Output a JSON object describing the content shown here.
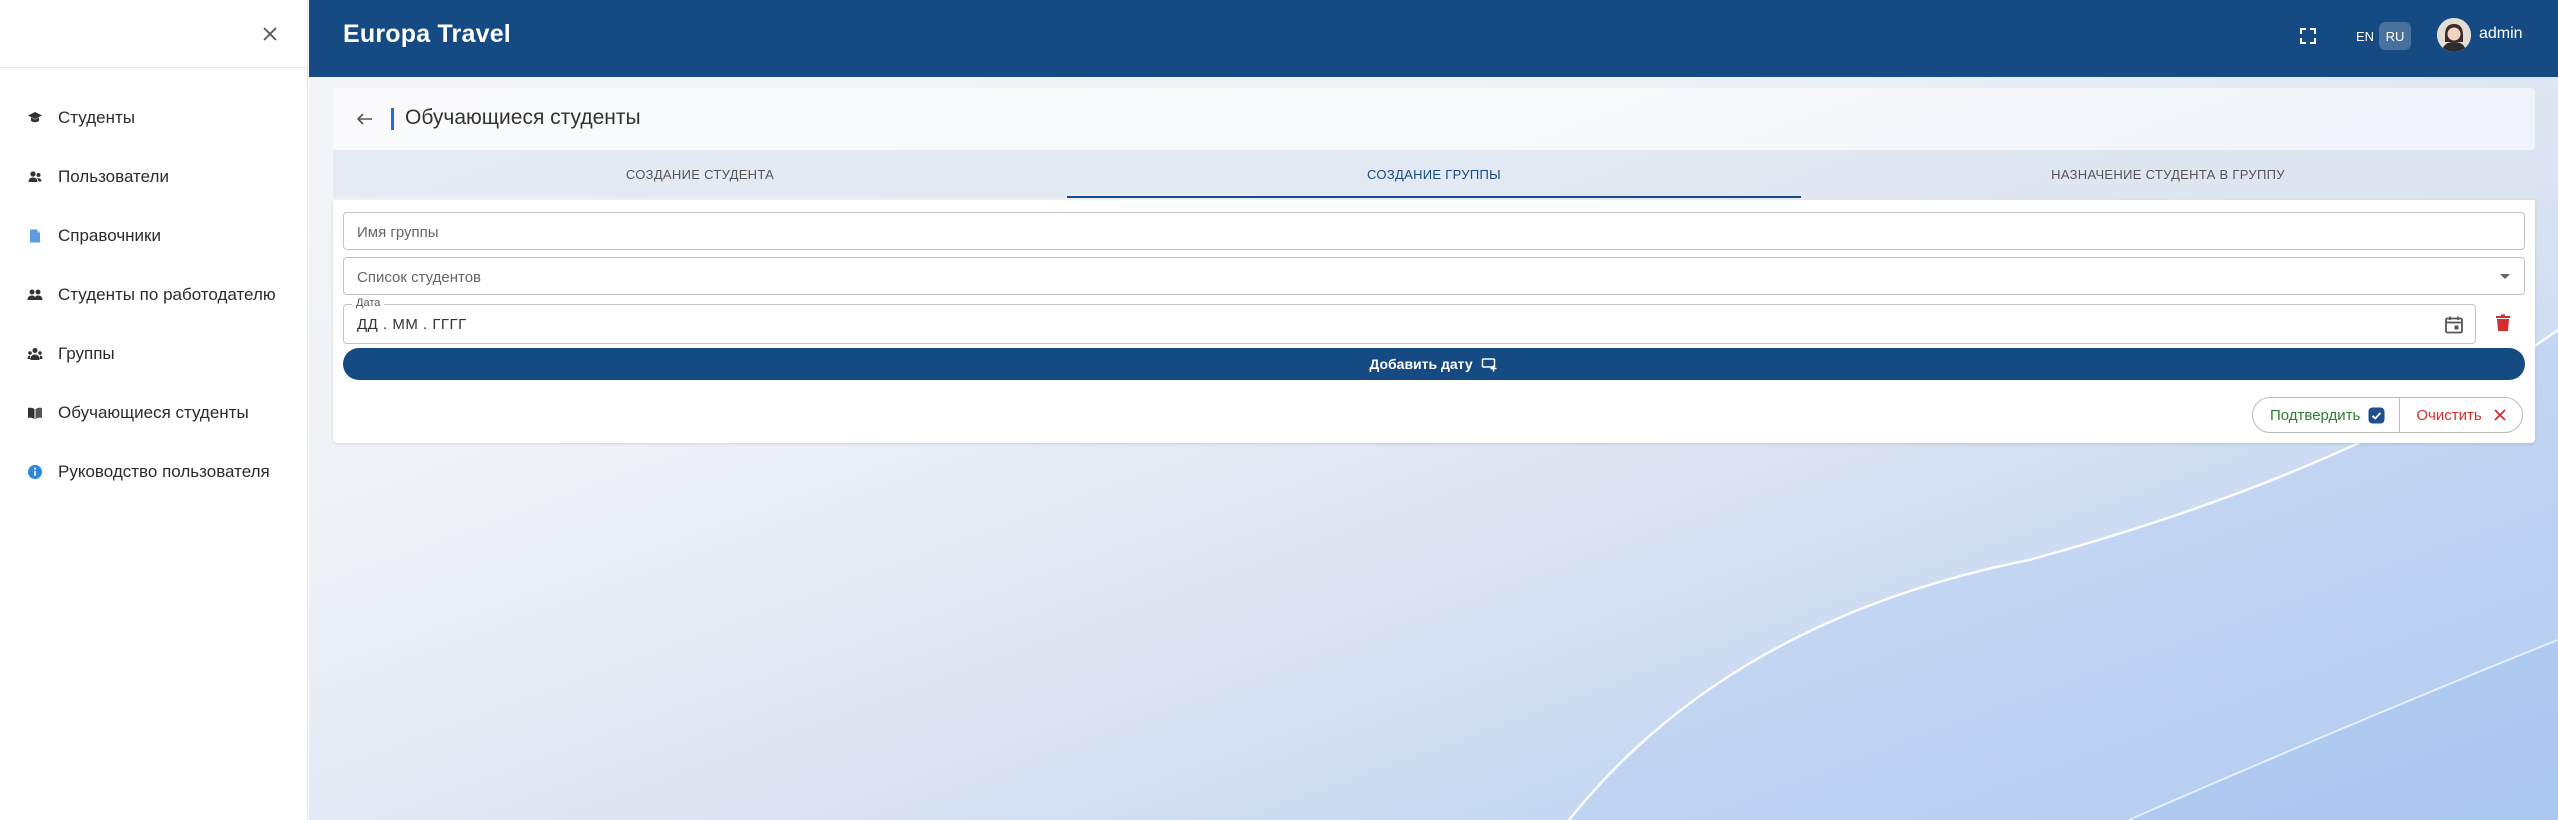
{
  "sidebar": {
    "items": [
      {
        "label": "Студенты",
        "icon": "graduation-cap-icon"
      },
      {
        "label": "Пользователи",
        "icon": "users-icon"
      },
      {
        "label": "Справочники",
        "icon": "document-icon"
      },
      {
        "label": "Студенты по работодателю",
        "icon": "user-group-icon"
      },
      {
        "label": "Группы",
        "icon": "people-group-icon"
      },
      {
        "label": "Обучающиеся студенты",
        "icon": "open-book-icon"
      },
      {
        "label": "Руководство пользователя",
        "icon": "info-icon"
      }
    ]
  },
  "header": {
    "brand": "Europa Travel",
    "lang_en": "EN",
    "lang_ru": "RU",
    "active_lang": "RU",
    "user": "admin"
  },
  "page": {
    "title": "Обучающиеся студенты"
  },
  "tabs": [
    {
      "label": "СОЗДАНИЕ СТУДЕНТА",
      "active": false
    },
    {
      "label": "СОЗДАНИЕ ГРУППЫ",
      "active": true
    },
    {
      "label": "НАЗНАЧЕНИЕ СТУДЕНТА В ГРУППУ",
      "active": false
    }
  ],
  "form": {
    "group_name_placeholder": "Имя группы",
    "students_placeholder": "Список студентов",
    "date_label": "Дата",
    "date_placeholder": "ДД . ММ . ГГГГ",
    "add_date": "Добавить дату",
    "confirm": "Подтвердить",
    "clear": "Очистить"
  },
  "colors": {
    "primary": "#154a82",
    "confirm": "#2e7d32",
    "danger": "#d32f2f",
    "accent": "#1e6fd9"
  }
}
